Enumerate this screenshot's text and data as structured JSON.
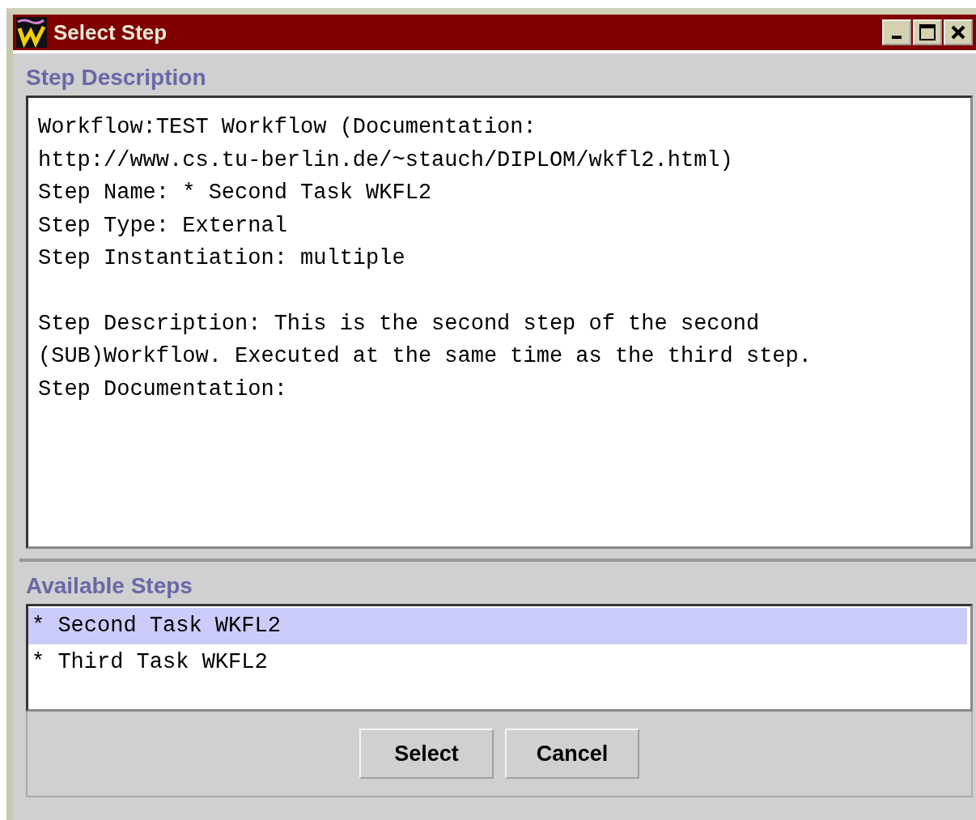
{
  "window": {
    "title": "Select Step"
  },
  "step_description": {
    "heading": "Step Description",
    "paragraphs": [
      {
        "lines": [
          "Workflow:TEST Workflow (Documentation:",
          "http://www.cs.tu-berlin.de/~stauch/DIPLOM/wkfl2.html)",
          "Step Name: * Second Task WKFL2",
          "Step Type: External",
          "Step Instantiation: multiple"
        ]
      },
      {
        "lines": [
          "Step Description: This is the second step of the second",
          "(SUB)Workflow. Executed at the same time as the third step.",
          "Step Documentation:"
        ]
      }
    ]
  },
  "available_steps": {
    "heading": "Available Steps",
    "items": [
      {
        "label": "* Second Task WKFL2",
        "selected": true
      },
      {
        "label": "* Third Task WKFL2",
        "selected": false
      }
    ]
  },
  "buttons": [
    "Select",
    "Cancel"
  ]
}
